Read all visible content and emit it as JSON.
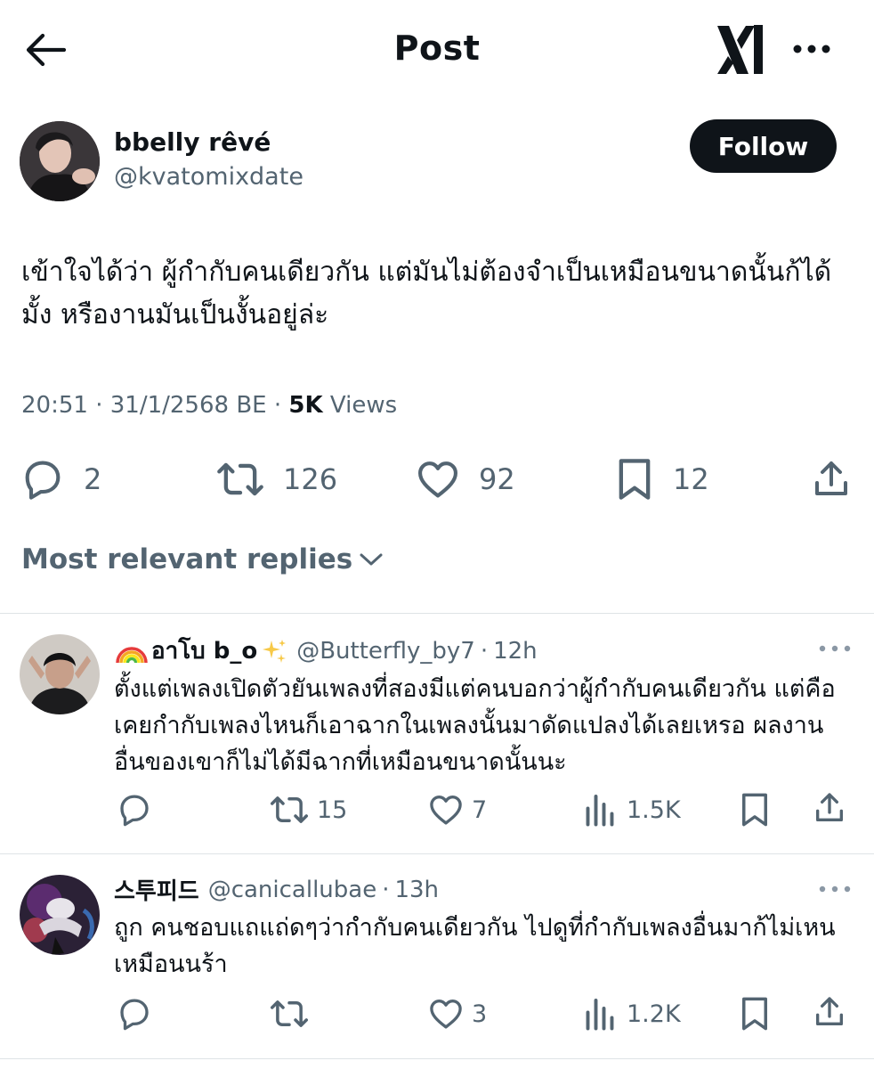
{
  "header": {
    "title": "Post",
    "back_icon": "back-arrow-icon",
    "logo_icon": "x-grok-logo-icon",
    "more_icon": "more-horizontal-icon"
  },
  "post": {
    "author_name": "bbelly rêvé",
    "author_handle": "@kvatomixdate",
    "follow_label": "Follow",
    "text": "เข้าใจได้ว่า ผู้กำกับคนเดียวกัน แต่มันไม่ต้องจำเป็นเหมือนขนาดนั้นก้ได้มั้ง หรืองานมันเป็นงั้นอยู่ล่ะ",
    "time": "20:51",
    "date": "31/1/2568 BE",
    "views_count": "5K",
    "views_label": "Views",
    "stats": {
      "replies": "2",
      "reposts": "126",
      "likes": "92",
      "bookmarks": "12"
    }
  },
  "replies_sort": {
    "label": "Most relevant replies"
  },
  "replies": [
    {
      "name_prefix_emoji": "🌈",
      "name": "อาโบ b_o",
      "name_suffix_emoji": "✨",
      "handle": "@Butterfly_by7",
      "time": "12h",
      "text": "ตั้งแต่เพลงเปิดตัวยันเพลงที่สองมีแต่คนบอกว่าผู้กำกับคนเดียวกัน แต่คือเคยกำกับเพลงไหนก็เอาฉากในเพลงนั้นมาดัดแปลงได้เลยเหรอ ผลงานอื่นของเขาก็ไม่ได้มีฉากที่เหมือนขนาดนั้นนะ",
      "stats": {
        "replies": "",
        "reposts": "15",
        "likes": "7",
        "views": "1.5K"
      }
    },
    {
      "name_prefix_emoji": "",
      "name": "스투피드",
      "name_suffix_emoji": "",
      "handle": "@canicallubae",
      "time": "13h",
      "text": "ถูก คนชอบแถแถ่ดๆว่ากำกับคนเดียวกัน ไปดูที่กำกับเพลงอื่นมาก้ไม่เหนเหมือนนร้า",
      "stats": {
        "replies": "",
        "reposts": "",
        "likes": "3",
        "views": "1.2K"
      }
    }
  ],
  "colors": {
    "text": "#0f1419",
    "muted": "#536471",
    "divider": "#dfe3e6",
    "follow_bg": "#0f1419"
  }
}
